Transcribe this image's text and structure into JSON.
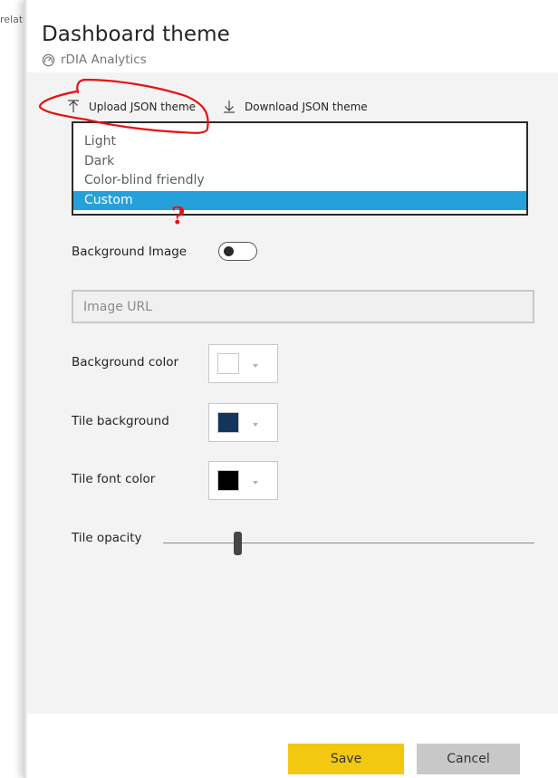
{
  "backdrop": {
    "text": "relate"
  },
  "dialog": {
    "title": "Dashboard theme",
    "subtitle": {
      "icon": "gauge-icon",
      "text": "rDIA Analytics"
    }
  },
  "json_actions": {
    "upload": {
      "icon": "upload-arrow-icon",
      "label": "Upload JSON theme"
    },
    "download": {
      "icon": "download-arrow-icon",
      "label": "Download JSON theme"
    }
  },
  "theme_list": {
    "options": [
      "Light",
      "Dark",
      "Color-blind friendly",
      "Custom"
    ],
    "selected": "Custom",
    "selected_color": "#26a0da"
  },
  "background_image": {
    "label": "Background Image",
    "enabled": false,
    "url_placeholder": "Image URL",
    "url_value": ""
  },
  "colors": {
    "background_color": {
      "label": "Background color",
      "value": "#ffffff"
    },
    "tile_background": {
      "label": "Tile background",
      "value": "#12355b"
    },
    "tile_font_color": {
      "label": "Tile font color",
      "value": "#000000"
    }
  },
  "tile_opacity": {
    "label": "Tile opacity",
    "value_percent": 20
  },
  "footer": {
    "save_label": "Save",
    "cancel_label": "Cancel",
    "save_color": "#f2c811",
    "cancel_color": "#c8c8c8"
  },
  "annotations": {
    "circle_color": "#e81010",
    "question_mark": "?"
  }
}
